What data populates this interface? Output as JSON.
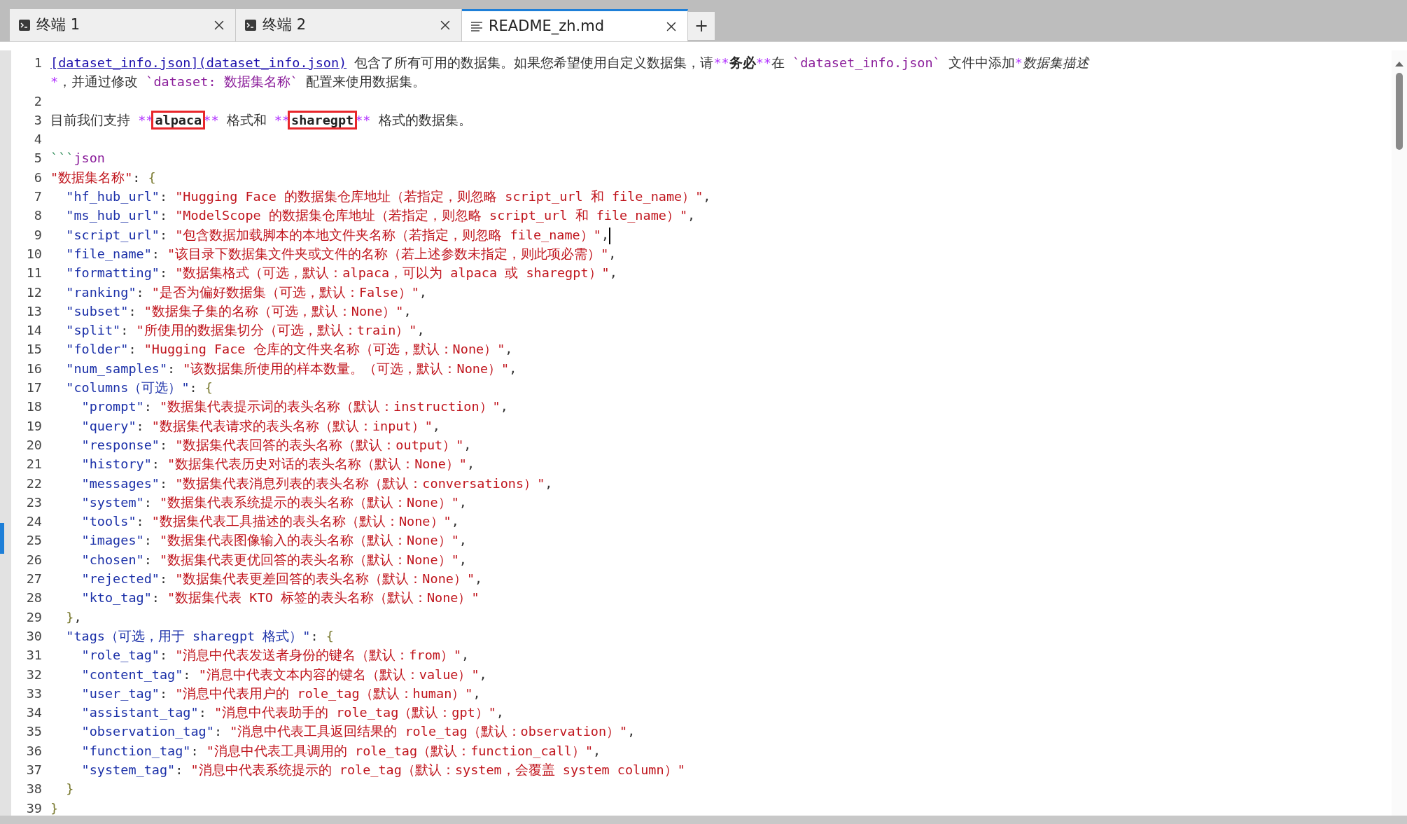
{
  "tabs": [
    {
      "label": "终端 1",
      "kind": "terminal",
      "selected": false
    },
    {
      "label": "终端 2",
      "kind": "terminal",
      "selected": false
    },
    {
      "label": "README_zh.md",
      "kind": "document",
      "selected": true
    }
  ],
  "new_tab": "+",
  "lines": [
    {
      "number": "1",
      "tokens": [
        {
          "kind": "link",
          "text": "[dataset_info.json](dataset_info.json)"
        },
        {
          "kind": "text",
          "text": " 包含了所有可用的数据集。如果您希望使用自定义数据集，请"
        },
        {
          "kind": "mark",
          "text": "**"
        },
        {
          "kind": "bold",
          "text": "务必"
        },
        {
          "kind": "mark",
          "text": "**"
        },
        {
          "kind": "text",
          "text": "在 "
        },
        {
          "kind": "code",
          "text": "`dataset_info.json`"
        },
        {
          "kind": "text",
          "text": " 文件中添加"
        },
        {
          "kind": "mark",
          "text": "*"
        },
        {
          "kind": "italic",
          "text": "数据集描述"
        },
        {
          "kind": "mark",
          "text": "*"
        },
        {
          "kind": "text",
          "text": "，并通过修改 "
        },
        {
          "kind": "code",
          "text": "`dataset: 数据集名称`"
        },
        {
          "kind": "text",
          "text": " 配置来"
        },
        {
          "kind": "text",
          "text": "使用数据集。"
        }
      ]
    },
    {
      "number": "2"
    },
    {
      "number": "3",
      "tokens": [
        {
          "kind": "text",
          "text": "目前我们支持 "
        },
        {
          "kind": "mark",
          "text": "**"
        },
        {
          "kind": "bold",
          "text": "alpaca",
          "boxed": true
        },
        {
          "kind": "mark",
          "text": "**"
        },
        {
          "kind": "text",
          "text": " 格式和 "
        },
        {
          "kind": "mark",
          "text": "**"
        },
        {
          "kind": "bold",
          "text": "sharegpt",
          "boxed": true
        },
        {
          "kind": "mark",
          "text": "**"
        },
        {
          "kind": "text",
          "text": " 格式的数据集。"
        }
      ]
    },
    {
      "number": "4"
    },
    {
      "number": "5",
      "tokens": [
        {
          "kind": "fence",
          "text": "```"
        },
        {
          "kind": "lang",
          "text": "json"
        }
      ]
    },
    {
      "number": "6",
      "tokens": [
        {
          "kind": "string",
          "text": "\"数据集名称\""
        },
        {
          "kind": "punct",
          "text": ": "
        },
        {
          "kind": "brace",
          "text": "{"
        }
      ]
    },
    {
      "number": "7",
      "tokens": [
        {
          "kind": "key",
          "text": "  \"hf_hub_url\""
        },
        {
          "kind": "punct",
          "text": ": "
        },
        {
          "kind": "string",
          "text": "\"Hugging Face 的数据集仓库地址（若指定，则忽略 script_url 和 file_name）\""
        },
        {
          "kind": "punct",
          "text": ","
        }
      ]
    },
    {
      "number": "8",
      "tokens": [
        {
          "kind": "key",
          "text": "  \"ms_hub_url\""
        },
        {
          "kind": "punct",
          "text": ": "
        },
        {
          "kind": "string",
          "text": "\"ModelScope 的数据集仓库地址（若指定，则忽略 script_url 和 file_name）\""
        },
        {
          "kind": "punct",
          "text": ","
        }
      ]
    },
    {
      "number": "9",
      "cursor": true,
      "tokens": [
        {
          "kind": "key",
          "text": "  \"script_url\""
        },
        {
          "kind": "punct",
          "text": ": "
        },
        {
          "kind": "string",
          "text": "\"包含数据加载脚本的本地文件夹名称（若指定，则忽略 file_name）\""
        },
        {
          "kind": "punct",
          "text": ","
        }
      ]
    },
    {
      "number": "10",
      "tokens": [
        {
          "kind": "key",
          "text": "  \"file_name\""
        },
        {
          "kind": "punct",
          "text": ": "
        },
        {
          "kind": "string",
          "text": "\"该目录下数据集文件夹或文件的名称（若上述参数未指定，则此项必需）\""
        },
        {
          "kind": "punct",
          "text": ","
        }
      ]
    },
    {
      "number": "11",
      "tokens": [
        {
          "kind": "key",
          "text": "  \"formatting\""
        },
        {
          "kind": "punct",
          "text": ": "
        },
        {
          "kind": "string",
          "text": "\"数据集格式（可选，默认：alpaca，可以为 alpaca 或 sharegpt）\""
        },
        {
          "kind": "punct",
          "text": ","
        }
      ]
    },
    {
      "number": "12",
      "tokens": [
        {
          "kind": "key",
          "text": "  \"ranking\""
        },
        {
          "kind": "punct",
          "text": ": "
        },
        {
          "kind": "string",
          "text": "\"是否为偏好数据集（可选，默认：False）\""
        },
        {
          "kind": "punct",
          "text": ","
        }
      ]
    },
    {
      "number": "13",
      "tokens": [
        {
          "kind": "key",
          "text": "  \"subset\""
        },
        {
          "kind": "punct",
          "text": ": "
        },
        {
          "kind": "string",
          "text": "\"数据集子集的名称（可选，默认：None）\""
        },
        {
          "kind": "punct",
          "text": ","
        }
      ]
    },
    {
      "number": "14",
      "tokens": [
        {
          "kind": "key",
          "text": "  \"split\""
        },
        {
          "kind": "punct",
          "text": ": "
        },
        {
          "kind": "string",
          "text": "\"所使用的数据集切分（可选，默认：train）\""
        },
        {
          "kind": "punct",
          "text": ","
        }
      ]
    },
    {
      "number": "15",
      "tokens": [
        {
          "kind": "key",
          "text": "  \"folder\""
        },
        {
          "kind": "punct",
          "text": ": "
        },
        {
          "kind": "string",
          "text": "\"Hugging Face 仓库的文件夹名称（可选，默认：None）\""
        },
        {
          "kind": "punct",
          "text": ","
        }
      ]
    },
    {
      "number": "16",
      "tokens": [
        {
          "kind": "key",
          "text": "  \"num_samples\""
        },
        {
          "kind": "punct",
          "text": ": "
        },
        {
          "kind": "string",
          "text": "\"该数据集所使用的样本数量。（可选，默认：None）\""
        },
        {
          "kind": "punct",
          "text": ","
        }
      ]
    },
    {
      "number": "17",
      "tokens": [
        {
          "kind": "key",
          "text": "  \"columns（可选）\""
        },
        {
          "kind": "punct",
          "text": ": "
        },
        {
          "kind": "brace",
          "text": "{"
        }
      ]
    },
    {
      "number": "18",
      "tokens": [
        {
          "kind": "key",
          "text": "    \"prompt\""
        },
        {
          "kind": "punct",
          "text": ": "
        },
        {
          "kind": "string",
          "text": "\"数据集代表提示词的表头名称（默认：instruction）\""
        },
        {
          "kind": "punct",
          "text": ","
        }
      ]
    },
    {
      "number": "19",
      "tokens": [
        {
          "kind": "key",
          "text": "    \"query\""
        },
        {
          "kind": "punct",
          "text": ": "
        },
        {
          "kind": "string",
          "text": "\"数据集代表请求的表头名称（默认：input）\""
        },
        {
          "kind": "punct",
          "text": ","
        }
      ]
    },
    {
      "number": "20",
      "tokens": [
        {
          "kind": "key",
          "text": "    \"response\""
        },
        {
          "kind": "punct",
          "text": ": "
        },
        {
          "kind": "string",
          "text": "\"数据集代表回答的表头名称（默认：output）\""
        },
        {
          "kind": "punct",
          "text": ","
        }
      ]
    },
    {
      "number": "21",
      "tokens": [
        {
          "kind": "key",
          "text": "    \"history\""
        },
        {
          "kind": "punct",
          "text": ": "
        },
        {
          "kind": "string",
          "text": "\"数据集代表历史对话的表头名称（默认：None）\""
        },
        {
          "kind": "punct",
          "text": ","
        }
      ]
    },
    {
      "number": "22",
      "tokens": [
        {
          "kind": "key",
          "text": "    \"messages\""
        },
        {
          "kind": "punct",
          "text": ": "
        },
        {
          "kind": "string",
          "text": "\"数据集代表消息列表的表头名称（默认：conversations）\""
        },
        {
          "kind": "punct",
          "text": ","
        }
      ]
    },
    {
      "number": "23",
      "tokens": [
        {
          "kind": "key",
          "text": "    \"system\""
        },
        {
          "kind": "punct",
          "text": ": "
        },
        {
          "kind": "string",
          "text": "\"数据集代表系统提示的表头名称（默认：None）\""
        },
        {
          "kind": "punct",
          "text": ","
        }
      ]
    },
    {
      "number": "24",
      "tokens": [
        {
          "kind": "key",
          "text": "    \"tools\""
        },
        {
          "kind": "punct",
          "text": ": "
        },
        {
          "kind": "string",
          "text": "\"数据集代表工具描述的表头名称（默认：None）\""
        },
        {
          "kind": "punct",
          "text": ","
        }
      ]
    },
    {
      "number": "25",
      "tokens": [
        {
          "kind": "key",
          "text": "    \"images\""
        },
        {
          "kind": "punct",
          "text": ": "
        },
        {
          "kind": "string",
          "text": "\"数据集代表图像输入的表头名称（默认：None）\""
        },
        {
          "kind": "punct",
          "text": ","
        }
      ]
    },
    {
      "number": "26",
      "tokens": [
        {
          "kind": "key",
          "text": "    \"chosen\""
        },
        {
          "kind": "punct",
          "text": ": "
        },
        {
          "kind": "string",
          "text": "\"数据集代表更优回答的表头名称（默认：None）\""
        },
        {
          "kind": "punct",
          "text": ","
        }
      ]
    },
    {
      "number": "27",
      "tokens": [
        {
          "kind": "key",
          "text": "    \"rejected\""
        },
        {
          "kind": "punct",
          "text": ": "
        },
        {
          "kind": "string",
          "text": "\"数据集代表更差回答的表头名称（默认：None）\""
        },
        {
          "kind": "punct",
          "text": ","
        }
      ]
    },
    {
      "number": "28",
      "tokens": [
        {
          "kind": "key",
          "text": "    \"kto_tag\""
        },
        {
          "kind": "punct",
          "text": ": "
        },
        {
          "kind": "string",
          "text": "\"数据集代表 KTO 标签的表头名称（默认：None）\""
        }
      ]
    },
    {
      "number": "29",
      "tokens": [
        {
          "kind": "brace",
          "text": "  }"
        },
        {
          "kind": "punct",
          "text": ","
        }
      ]
    },
    {
      "number": "30",
      "tokens": [
        {
          "kind": "key",
          "text": "  \"tags（可选，用于 sharegpt 格式）\""
        },
        {
          "kind": "punct",
          "text": ": "
        },
        {
          "kind": "brace",
          "text": "{"
        }
      ]
    },
    {
      "number": "31",
      "tokens": [
        {
          "kind": "key",
          "text": "    \"role_tag\""
        },
        {
          "kind": "punct",
          "text": ": "
        },
        {
          "kind": "string",
          "text": "\"消息中代表发送者身份的键名（默认：from）\""
        },
        {
          "kind": "punct",
          "text": ","
        }
      ]
    },
    {
      "number": "32",
      "tokens": [
        {
          "kind": "key",
          "text": "    \"content_tag\""
        },
        {
          "kind": "punct",
          "text": ": "
        },
        {
          "kind": "string",
          "text": "\"消息中代表文本内容的键名（默认：value）\""
        },
        {
          "kind": "punct",
          "text": ","
        }
      ]
    },
    {
      "number": "33",
      "tokens": [
        {
          "kind": "key",
          "text": "    \"user_tag\""
        },
        {
          "kind": "punct",
          "text": ": "
        },
        {
          "kind": "string",
          "text": "\"消息中代表用户的 role_tag（默认：human）\""
        },
        {
          "kind": "punct",
          "text": ","
        }
      ]
    },
    {
      "number": "34",
      "tokens": [
        {
          "kind": "key",
          "text": "    \"assistant_tag\""
        },
        {
          "kind": "punct",
          "text": ": "
        },
        {
          "kind": "string",
          "text": "\"消息中代表助手的 role_tag（默认：gpt）\""
        },
        {
          "kind": "punct",
          "text": ","
        }
      ]
    },
    {
      "number": "35",
      "tokens": [
        {
          "kind": "key",
          "text": "    \"observation_tag\""
        },
        {
          "kind": "punct",
          "text": ": "
        },
        {
          "kind": "string",
          "text": "\"消息中代表工具返回结果的 role_tag（默认：observation）\""
        },
        {
          "kind": "punct",
          "text": ","
        }
      ]
    },
    {
      "number": "36",
      "tokens": [
        {
          "kind": "key",
          "text": "    \"function_tag\""
        },
        {
          "kind": "punct",
          "text": ": "
        },
        {
          "kind": "string",
          "text": "\"消息中代表工具调用的 role_tag（默认：function_call）\""
        },
        {
          "kind": "punct",
          "text": ","
        }
      ]
    },
    {
      "number": "37",
      "tokens": [
        {
          "kind": "key",
          "text": "    \"system_tag\""
        },
        {
          "kind": "punct",
          "text": ": "
        },
        {
          "kind": "string",
          "text": "\"消息中代表系统提示的 role_tag（默认：system，会覆盖 system column）\""
        }
      ]
    },
    {
      "number": "38",
      "tokens": [
        {
          "kind": "brace",
          "text": "  }"
        }
      ]
    },
    {
      "number": "39",
      "tokens": [
        {
          "kind": "brace",
          "text": "}"
        }
      ]
    }
  ]
}
